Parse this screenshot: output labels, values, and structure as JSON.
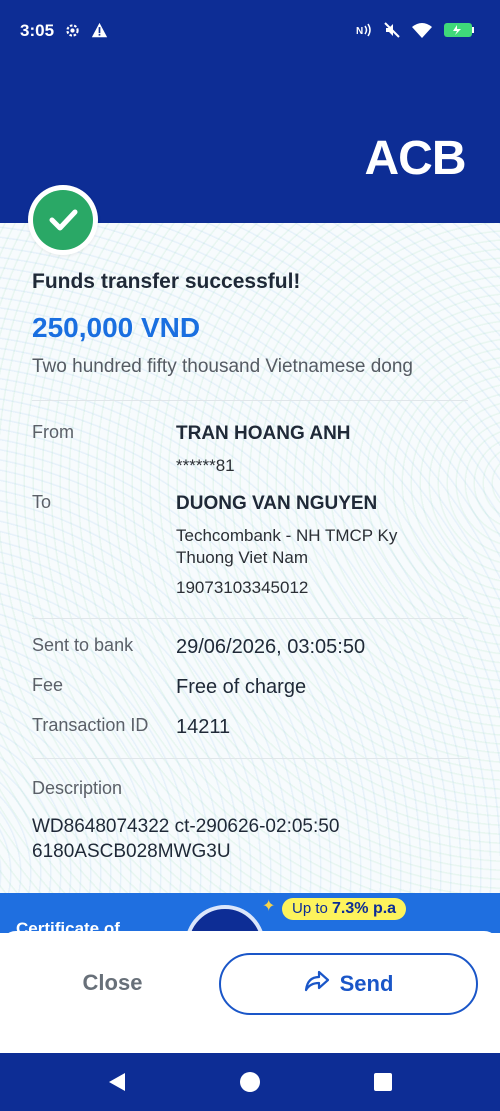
{
  "status_bar": {
    "time": "3:05"
  },
  "header": {
    "logo_text": "ACB"
  },
  "receipt": {
    "title": "Funds transfer successful!",
    "amount": "250,000 VND",
    "amount_words": "Two hundred fifty thousand Vietnamese dong",
    "from": {
      "label": "From",
      "name": "TRAN HOANG ANH",
      "account": "******81"
    },
    "to": {
      "label": "To",
      "name": "DUONG VAN NGUYEN",
      "bank_line1": "Techcombank - NH TMCP Ky",
      "bank_line2": "Thuong Viet Nam",
      "account": "19073103345012"
    },
    "sent_to_bank": {
      "label": "Sent to bank",
      "value": "29/06/2026, 03:05:50"
    },
    "fee": {
      "label": "Fee",
      "value": "Free of charge"
    },
    "transaction_id": {
      "label": "Transaction ID",
      "value": "14211"
    },
    "description": {
      "label": "Description",
      "line1": "WD8648074322 ct-290626-02:05:50",
      "line2": "6180ASCB028MWG3U"
    }
  },
  "banner": {
    "text": "Certificate of",
    "rate_prefix": "Up to",
    "rate_value": "7.3% p.a"
  },
  "actions": {
    "close_label": "Close",
    "send_label": "Send"
  },
  "colors": {
    "brand_blue": "#0d2d95",
    "accent_blue": "#1a6fe0",
    "success_green": "#2aa866"
  },
  "icons": [
    "gear-icon",
    "warning-icon",
    "nfc-icon",
    "mute-icon",
    "wifi-icon",
    "battery-icon",
    "check-icon",
    "share-icon",
    "back-icon",
    "home-icon",
    "recents-icon"
  ]
}
